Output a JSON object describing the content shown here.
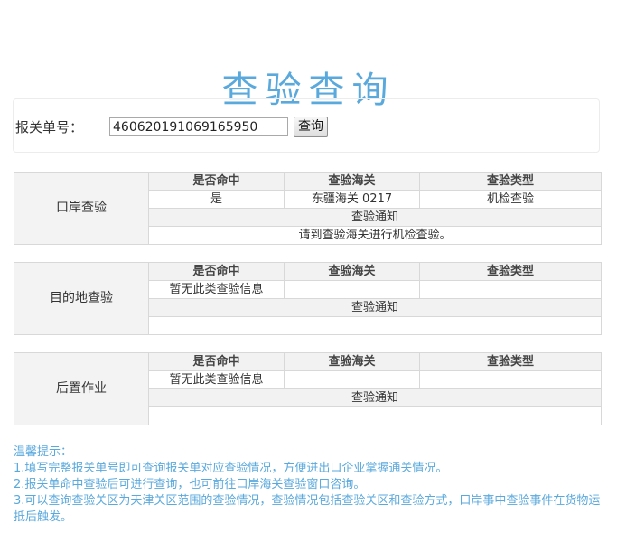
{
  "page": {
    "title": "查验查询"
  },
  "search": {
    "label": "报关单号：",
    "value": "460620191069165950",
    "button_label": "查询"
  },
  "columns": {
    "hit": "是否命中",
    "customs": "查验海关",
    "type": "查验类型",
    "notice": "查验通知"
  },
  "sections": [
    {
      "category": "口岸查验",
      "hit": "是",
      "customs": "东疆海关 0217",
      "type": "机检查验",
      "notice": "请到查验海关进行机检查验。"
    },
    {
      "category": "目的地查验",
      "hit": "暂无此类查验信息",
      "customs": "",
      "type": "",
      "notice": ""
    },
    {
      "category": "后置作业",
      "hit": "暂无此类查验信息",
      "customs": "",
      "type": "",
      "notice": ""
    }
  ],
  "tips": {
    "heading": "温馨提示：",
    "items": [
      "1.填写完整报关单号即可查询报关单对应查验情况，方便进出口企业掌握通关情况。",
      "2.报关单命中查验后可进行查询，也可前往口岸海关查验窗口咨询。",
      "3.可以查询查验关区为天津关区范围的查验情况，查验情况包括查验关区和查验方式，口岸事中查验事件在货物运抵后触发。"
    ]
  },
  "colors": {
    "accent": "#5aa9dd",
    "header_bg": "#f2f2f2",
    "border": "#d8d8d8"
  }
}
